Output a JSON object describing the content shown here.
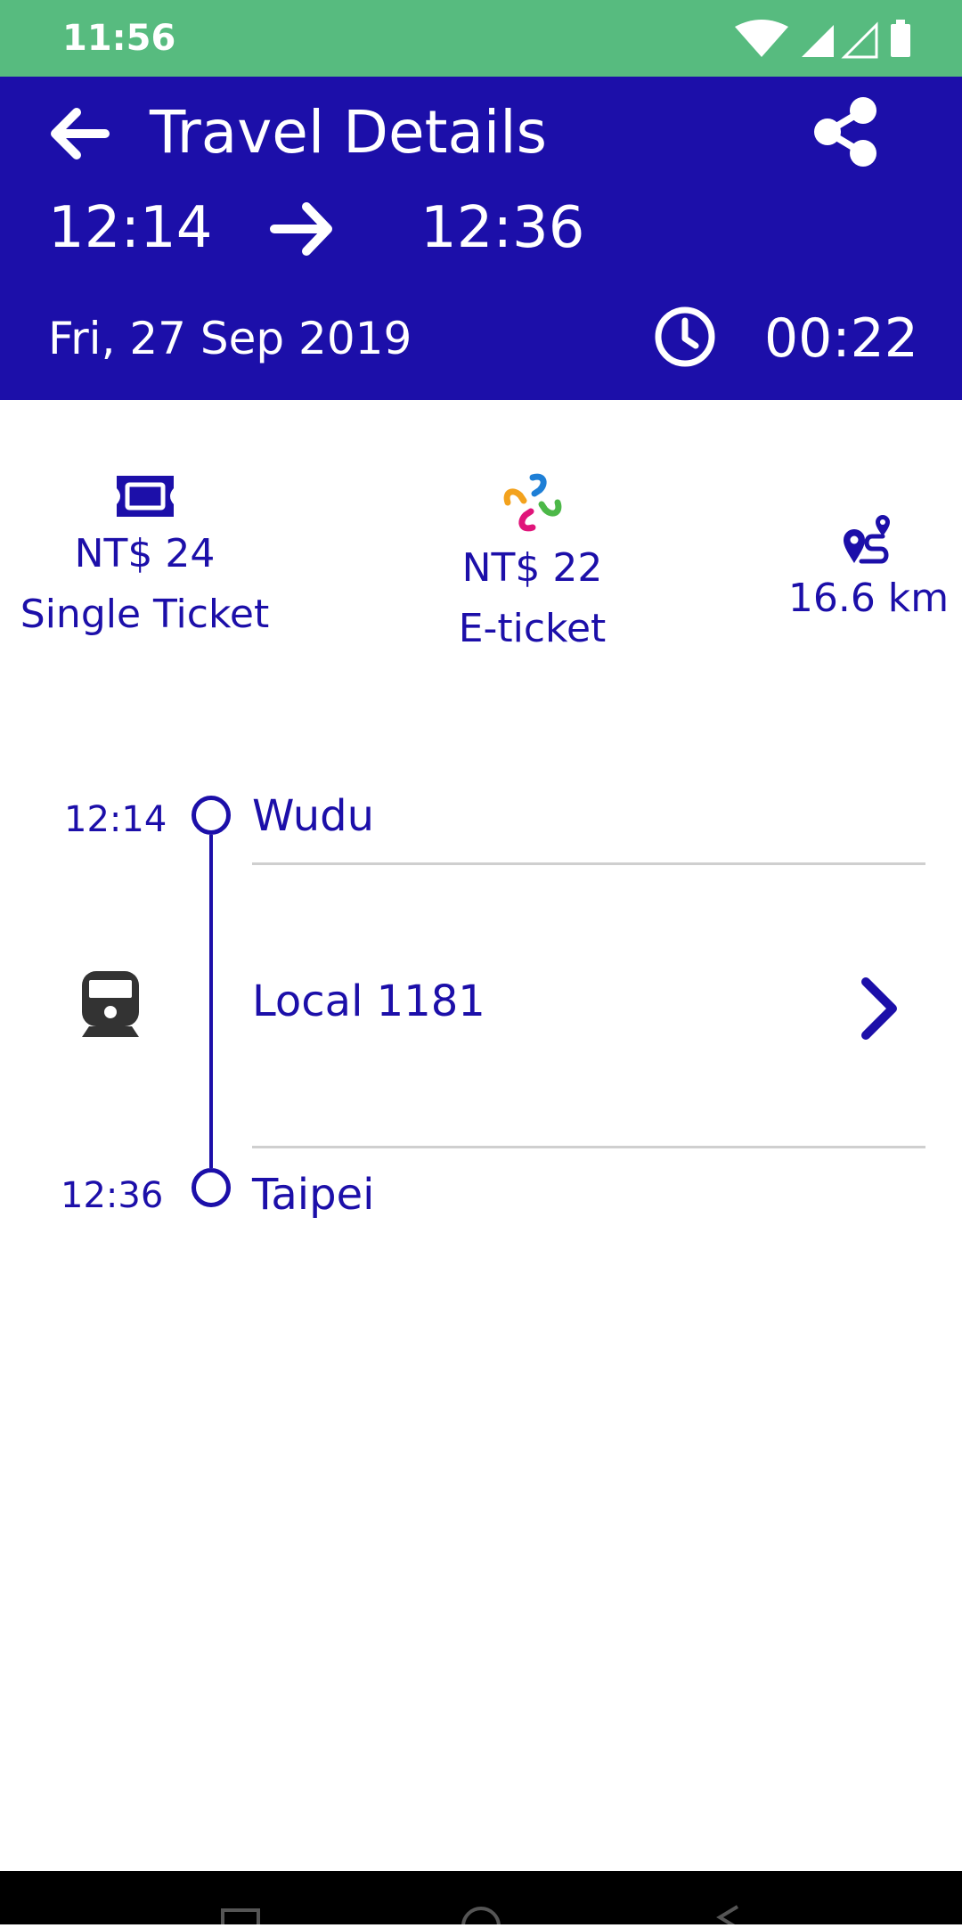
{
  "status_bar": {
    "time": "11:56",
    "icons": [
      "wifi-icon",
      "signal-icon",
      "signal-empty-icon",
      "battery-icon"
    ]
  },
  "header": {
    "title": "Travel Details",
    "departure_time": "12:14",
    "arrival_time": "12:36",
    "date": "Fri, 27 Sep 2019",
    "duration": "00:22",
    "back_icon": "arrow-left-icon",
    "share_icon": "share-icon"
  },
  "fares": [
    {
      "price": "NT$ 24",
      "label": "Single Ticket",
      "icon": "ticket-icon"
    },
    {
      "price": "NT$ 22",
      "label": "E-ticket",
      "icon": "eticket-logo-icon"
    }
  ],
  "distance": {
    "value": "16.6 km",
    "icon": "route-icon"
  },
  "journey": {
    "departure": {
      "time": "12:14",
      "station": "Wudu"
    },
    "service": {
      "name": "Local 1181",
      "icon": "train-icon"
    },
    "arrival": {
      "time": "12:36",
      "station": "Taipei"
    }
  },
  "colors": {
    "status_bar": "#57bb7f",
    "header": "#1c0fa9",
    "accent": "#1c0fa9",
    "divider": "#cfcfcf"
  }
}
